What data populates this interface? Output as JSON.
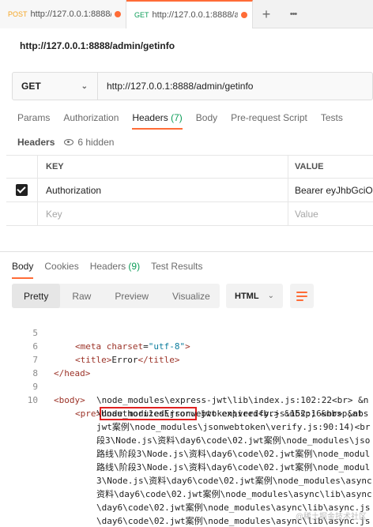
{
  "tabs": [
    {
      "method": "POST",
      "url": "http://127.0.0.1:8888/a",
      "unsaved": true
    },
    {
      "method": "GET",
      "url": "http://127.0.0.1:8888/ac",
      "unsaved": true
    }
  ],
  "new_tab_icon": "+",
  "more_tabs_icon": "•••",
  "request_title": "http://127.0.0.1:8888/admin/getinfo",
  "request": {
    "method": "GET",
    "url": "http://127.0.0.1:8888/admin/getinfo"
  },
  "request_tabs": {
    "params": "Params",
    "authorization": "Authorization",
    "headers": "Headers",
    "headers_count": "(7)",
    "body": "Body",
    "prerequest": "Pre-request Script",
    "tests": "Tests"
  },
  "headers_section": {
    "label": "Headers",
    "hidden": "6 hidden"
  },
  "headers_table": {
    "col_key": "KEY",
    "col_value": "VALUE",
    "rows": [
      {
        "key": "Authorization",
        "value": "Bearer eyJhbGciOi"
      }
    ],
    "placeholder": {
      "key": "Key",
      "value": "Value"
    }
  },
  "response_tabs": {
    "body": "Body",
    "cookies": "Cookies",
    "headers": "Headers",
    "headers_count": "(9)",
    "test_results": "Test Results"
  },
  "view_modes": [
    "Pretty",
    "Raw",
    "Preview",
    "Visualize"
  ],
  "active_view": "Pretty",
  "format": "HTML",
  "accent_color": "#ff6c37",
  "code_lines": [
    {
      "n": "5",
      "t": "<meta charset=\"utf-8\">"
    },
    {
      "n": "6",
      "t": "<title>Error</title>"
    },
    {
      "n": "7",
      "t": "</head>"
    },
    {
      "n": "8",
      "t": ""
    },
    {
      "n": "9",
      "t": "<body>"
    },
    {
      "n": "10",
      "t": "<pre>UnauthorizedError: jwt expired<br> &nbsp; &nbsp;at"
    }
  ],
  "code_wrapped": [
    "\\node_modules\\express-jwt\\lib\\index.js:102:22<br> &n",
    "\\node_modules\\jsonwebtoken\\verify.js:152:16<br> &nbs",
    "jwt案例\\node_modules\\jsonwebtoken\\verify.js:90:14)<br",
    "段3\\Node.js\\资料\\day6\\code\\02.jwt案例\\node_modules\\jso",
    "路线\\阶段3\\Node.js\\资料\\day6\\code\\02.jwt案例\\node_modul",
    "路线\\阶段3\\Node.js\\资料\\day6\\code\\02.jwt案例\\node_modul",
    "3\\Node.js\\资料\\day6\\code\\02.jwt案例\\node_modules\\async",
    "资料\\day6\\code\\02.jwt案例\\node_modules\\async\\lib\\async",
    "\\day6\\code\\02.jwt案例\\node_modules\\async\\lib\\async.js",
    "\\day6\\code\\02.jwt案例\\node_modules\\async\\lib\\async.js"
  ],
  "watermark": "@稀土掘金技术社区"
}
